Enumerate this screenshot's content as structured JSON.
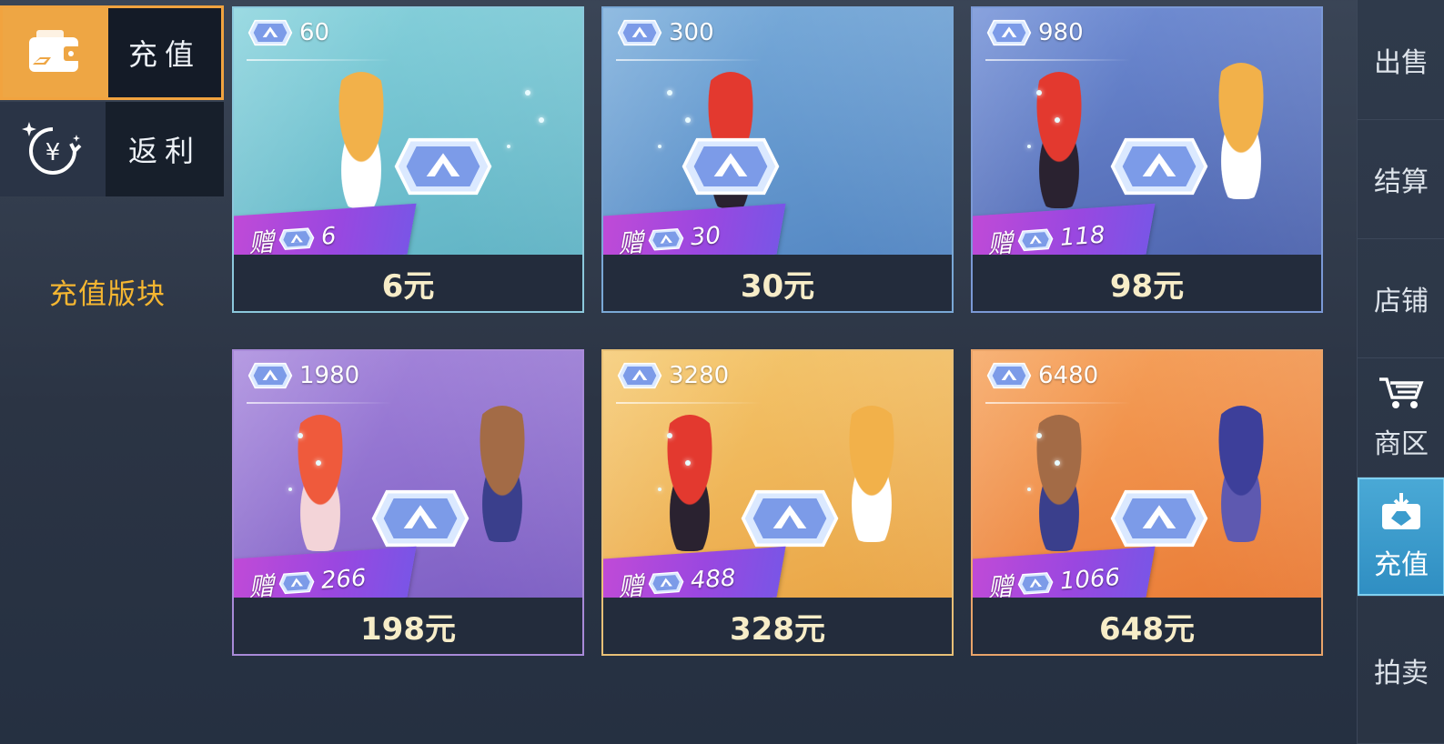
{
  "left_tabs": [
    {
      "label": "充值",
      "icon": "wallet-icon",
      "active": true
    },
    {
      "label": "返利",
      "icon": "yuan-rebate-icon",
      "active": false
    }
  ],
  "section_label": "充值版块",
  "right_nav": [
    {
      "label": "出售",
      "icon": null,
      "active": false
    },
    {
      "label": "结算",
      "icon": null,
      "active": false
    },
    {
      "label": "店铺",
      "icon": null,
      "active": false
    },
    {
      "label": "商区",
      "icon": "cart-icon",
      "active": false
    },
    {
      "label": "充值",
      "icon": "recharge-icon",
      "active": true
    },
    {
      "label": "拍卖",
      "icon": null,
      "active": false
    }
  ],
  "colors": {
    "accent": "#eea644",
    "section_label": "#f5b631",
    "price_text": "#f7edc8",
    "bonus_ribbon": "#b04ade"
  },
  "packages": [
    {
      "gems": "60",
      "bonus": "6",
      "price": "6元",
      "bg": [
        "#86d2dc",
        "#5fb2c4"
      ],
      "border": "#8cc8dc"
    },
    {
      "gems": "300",
      "bonus": "30",
      "price": "30元",
      "bg": [
        "#79addb",
        "#5285c2"
      ],
      "border": "#7aa8d6"
    },
    {
      "gems": "980",
      "bonus": "118",
      "price": "98元",
      "bg": [
        "#6f8ed6",
        "#4d63ad"
      ],
      "border": "#7b99d6"
    },
    {
      "gems": "1980",
      "bonus": "266",
      "price": "198元",
      "bg": [
        "#a686dc",
        "#7a5cc2"
      ],
      "border": "#a88ad8"
    },
    {
      "gems": "3280",
      "bonus": "488",
      "price": "328元",
      "bg": [
        "#f5c86d",
        "#e9a344"
      ],
      "border": "#e8c077"
    },
    {
      "gems": "6480",
      "bonus": "1066",
      "price": "648元",
      "bg": [
        "#f6a25a",
        "#e97a35"
      ],
      "border": "#e9a46a"
    }
  ]
}
